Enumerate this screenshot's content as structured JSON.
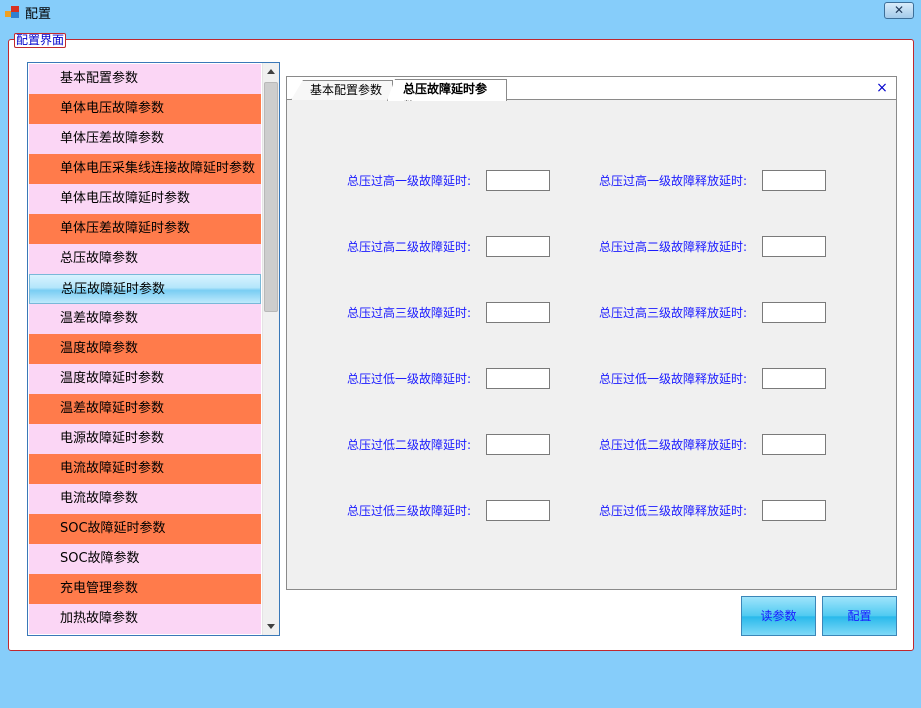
{
  "window": {
    "title": "配置",
    "close_symbol": "✕"
  },
  "group": {
    "legend": "配置界面"
  },
  "list": {
    "items": [
      {
        "label": "基本配置参数",
        "style": "pink"
      },
      {
        "label": "单体电压故障参数",
        "style": "orange"
      },
      {
        "label": "单体压差故障参数",
        "style": "pink"
      },
      {
        "label": "单体电压采集线连接故障延时参数",
        "style": "orange"
      },
      {
        "label": "单体电压故障延时参数",
        "style": "pink"
      },
      {
        "label": "单体压差故障延时参数",
        "style": "orange"
      },
      {
        "label": "总压故障参数",
        "style": "pink"
      },
      {
        "label": "总压故障延时参数",
        "style": "selected"
      },
      {
        "label": "温差故障参数",
        "style": "pink"
      },
      {
        "label": "温度故障参数",
        "style": "orange"
      },
      {
        "label": "温度故障延时参数",
        "style": "pink"
      },
      {
        "label": "温差故障延时参数",
        "style": "orange"
      },
      {
        "label": "电源故障延时参数",
        "style": "pink"
      },
      {
        "label": "电流故障延时参数",
        "style": "orange"
      },
      {
        "label": "电流故障参数",
        "style": "pink"
      },
      {
        "label": "SOC故障延时参数",
        "style": "orange"
      },
      {
        "label": "SOC故障参数",
        "style": "pink"
      },
      {
        "label": "充电管理参数",
        "style": "orange"
      },
      {
        "label": "加热故障参数",
        "style": "pink"
      }
    ]
  },
  "tabs": {
    "items": [
      "基本配置参数",
      "总压故障延时参数"
    ],
    "active_index": 1,
    "close_symbol": "×"
  },
  "form": {
    "left_labels": [
      "总压过高一级故障延时:",
      "总压过高二级故障延时:",
      "总压过高三级故障延时:",
      "总压过低一级故障延时:",
      "总压过低二级故障延时:",
      "总压过低三级故障延时:"
    ],
    "right_labels": [
      "总压过高一级故障释放延时:",
      "总压过高二级故障释放延时:",
      "总压过高三级故障释放延时:",
      "总压过低一级故障释放延时:",
      "总压过低二级故障释放延时:",
      "总压过低三级故障释放延时:"
    ],
    "left_values": [
      "",
      "",
      "",
      "",
      "",
      ""
    ],
    "right_values": [
      "",
      "",
      "",
      "",
      "",
      ""
    ]
  },
  "buttons": {
    "read_label": "读参数",
    "config_label": "配置"
  },
  "colors": {
    "window_bg": "#86cdfa",
    "list_pink": "#fbd6f5",
    "list_orange": "#ff7b4b",
    "label_blue": "#1a1aff",
    "group_border": "#c0282e"
  }
}
